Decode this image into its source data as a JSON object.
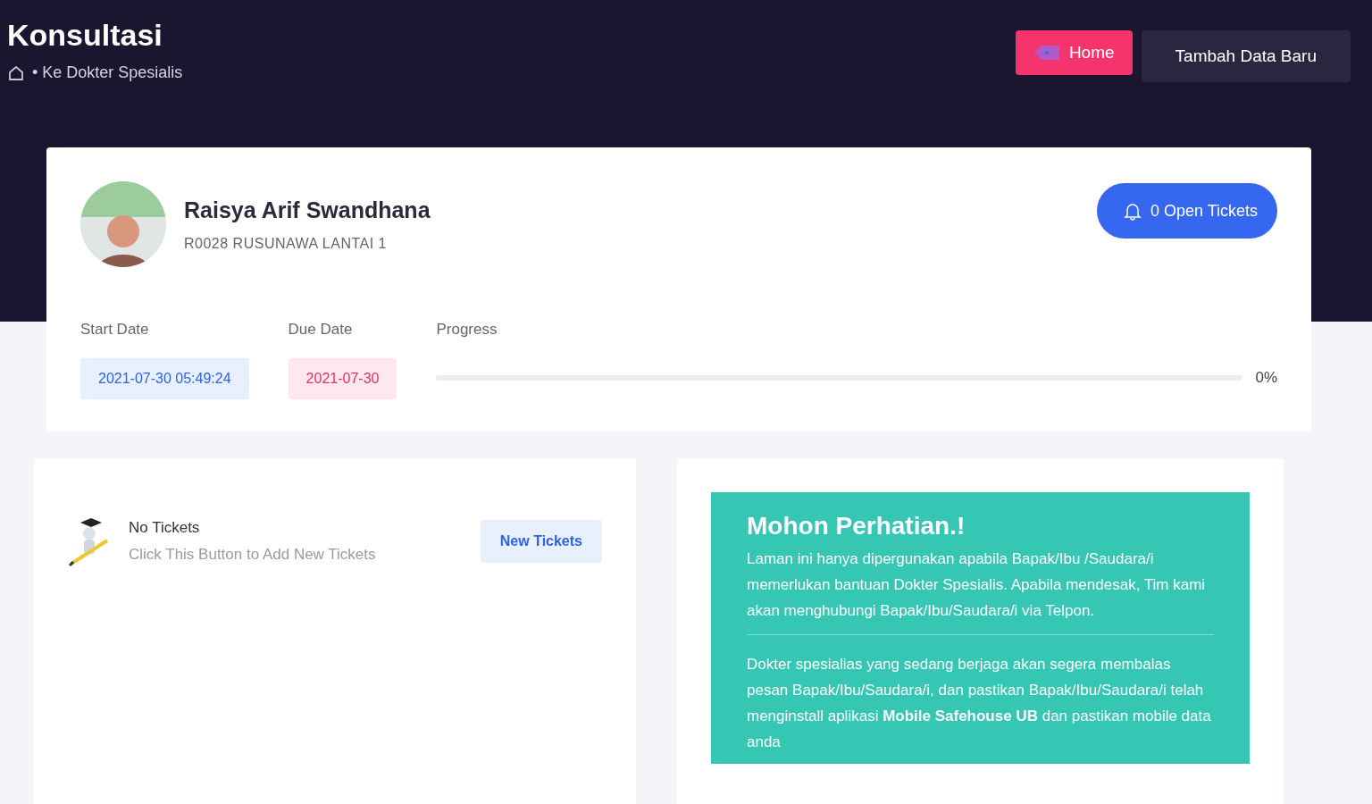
{
  "header": {
    "title": "Konsultasi",
    "breadcrumb": "• Ke Dokter Spesialis"
  },
  "header_buttons": [
    {
      "label": "Home",
      "kind": "primary"
    },
    {
      "label": "Tambah Data Baru",
      "kind": "secondary"
    }
  ],
  "profile": {
    "name": "Raisya Arif Swandhana",
    "location": "R0028 RUSUNAWA LANTAI 1",
    "tickets_button": "0 Open Tickets"
  },
  "dates": [
    {
      "label": "Start Date",
      "value": "2021-07-30 05:49:24",
      "kind": "start"
    },
    {
      "label": "Due Date",
      "value": "2021-07-30",
      "kind": "due"
    }
  ],
  "progress": {
    "label": "Progress",
    "level": 0,
    "reading": "0%"
  },
  "tickets_panel": {
    "title": "No Tickets",
    "subtitle": "Click This Button to Add New Tickets",
    "button": "New Tickets"
  },
  "notice": {
    "title": "Mohon Perhatian.!",
    "paragraphs": [
      "Laman ini hanya dipergunakan apabila Bapak/Ibu /Saudara/i memerlukan bantuan Dokter Spesialis. Apabila mendesak, Tim kami akan menghubungi Bapak/Ibu/Saudara/i via Telpon.",
      "Dokter spesialias yang sedang berjaga akan segera membalas pesan Bapak/Ibu/Saudara/i, dan pastikan Bapak/Ibu/Saudara/i telah menginstall aplikasi **Mobile Safehouse UB** dan pastikan mobile data anda"
    ]
  }
}
